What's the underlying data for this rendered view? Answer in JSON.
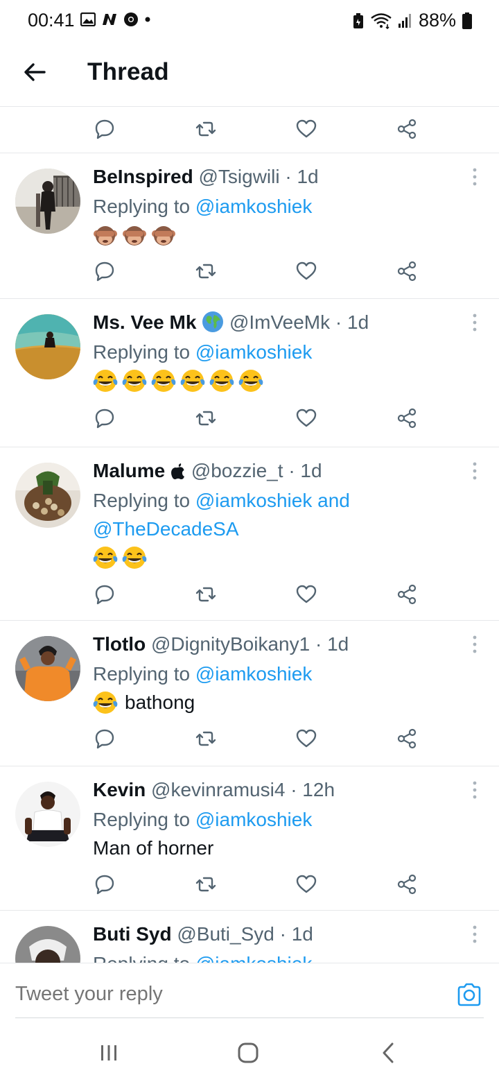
{
  "status_bar": {
    "time": "00:41",
    "battery": "88%",
    "left_icons": [
      "gallery-icon",
      "n-app-icon",
      "chrome-icon",
      "dot-icon"
    ],
    "right_icons": [
      "battery-saver-icon",
      "wifi-icon",
      "signal-icon",
      "battery-icon"
    ]
  },
  "header": {
    "title": "Thread",
    "back_icon": "arrow-left-icon"
  },
  "tweets": [
    {
      "name": "BeInspired",
      "handle": "@Tsigwili",
      "time": "1d",
      "replying_prefix": "Replying to",
      "replying_to": "@iamkoshiek",
      "emoji": [
        "see-no-evil-monkey",
        "see-no-evil-monkey",
        "see-no-evil-monkey"
      ]
    },
    {
      "name": "Ms. Vee Mk",
      "name_badge": "globe-icon",
      "handle": "@ImVeeMk",
      "time": "1d",
      "replying_prefix": "Replying to",
      "replying_to": "@iamkoshiek",
      "emoji": [
        "tears-of-joy",
        "tears-of-joy",
        "tears-of-joy",
        "tears-of-joy",
        "tears-of-joy",
        "tears-of-joy"
      ]
    },
    {
      "name": "Malume",
      "name_badge": "apple-icon",
      "handle": "@bozzie_t",
      "time": "1d",
      "replying_prefix": "Replying to",
      "replying_to": "@iamkoshiek and",
      "replying_to_2": "@TheDecadeSA",
      "emoji": [
        "tears-of-joy",
        "tears-of-joy"
      ]
    },
    {
      "name": "Tlotlo",
      "handle": "@DignityBoikany1",
      "time": "1d",
      "replying_prefix": "Replying to",
      "replying_to": "@iamkoshiek",
      "emoji": [
        "tears-of-joy"
      ],
      "text": "bathong"
    },
    {
      "name": "Kevin",
      "handle": "@kevinramusi4",
      "time": "12h",
      "replying_prefix": "Replying to",
      "replying_to": "@iamkoshiek",
      "text": "Man of horner"
    },
    {
      "name": "Buti Syd",
      "handle": "@Buti_Syd",
      "time": "1d",
      "replying_prefix": "Replying to",
      "replying_to": "@iamkoshiek"
    }
  ],
  "sep": "·",
  "reply_bar": {
    "placeholder": "Tweet your reply"
  },
  "colors": {
    "link": "#1d9bf0",
    "secondary": "#536471",
    "divider": "#e6e8ea"
  }
}
